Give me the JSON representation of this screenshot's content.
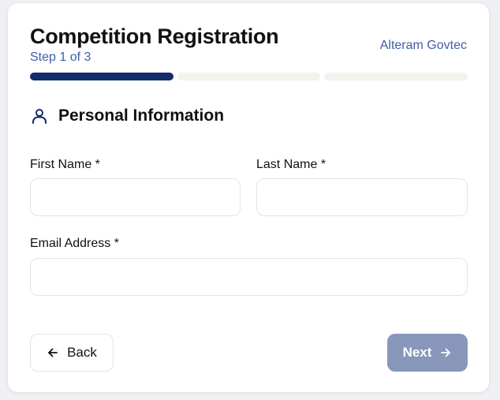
{
  "header": {
    "title": "Competition Registration",
    "step": "Step 1 of 3",
    "brand": "Alteram Govtec"
  },
  "progress": {
    "current_step": 1,
    "total_steps": 3
  },
  "section": {
    "icon": "user-icon",
    "title": "Personal Information"
  },
  "fields": {
    "first_name": {
      "label": "First Name *",
      "value": "",
      "placeholder": ""
    },
    "last_name": {
      "label": "Last Name *",
      "value": "",
      "placeholder": ""
    },
    "email": {
      "label": "Email Address *",
      "value": "",
      "placeholder": ""
    }
  },
  "actions": {
    "back_label": "Back",
    "back_icon": "arrow-left-icon",
    "next_label": "Next",
    "next_icon": "arrow-right-icon"
  },
  "colors": {
    "accent": "#132d6b",
    "link": "#3f5fa8",
    "next_button_disabled": "#8897b9",
    "progress_inactive": "#f5f1ed"
  }
}
